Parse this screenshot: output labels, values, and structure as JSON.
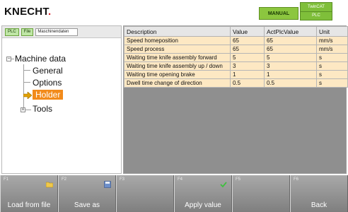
{
  "header": {
    "logo": "KNECHT",
    "logo_dot": ".",
    "mode": "MANUAL",
    "plc_top": "TwinCAT",
    "plc_bottom": "PLC"
  },
  "tree_header": {
    "plc_btn": "PLC",
    "file_btn": "File",
    "path": "Maschinendaten"
  },
  "tree": {
    "root": "Machine data",
    "items": [
      "General",
      "Options",
      "Holder",
      "Tools"
    ],
    "selected_index": 2
  },
  "table": {
    "columns": [
      "Description",
      "Value",
      "ActPlcValue",
      "Unit"
    ],
    "rows": [
      {
        "desc": "Speed homeposition",
        "val": "65",
        "act": "65",
        "unit": "mm/s"
      },
      {
        "desc": "Speed process",
        "val": "65",
        "act": "65",
        "unit": "mm/s"
      },
      {
        "desc": "Waiting time knife assembly forward",
        "val": "5",
        "act": "5",
        "unit": "s"
      },
      {
        "desc": "Waiting time knife assembly up / down",
        "val": "3",
        "act": "3",
        "unit": "s"
      },
      {
        "desc": "Waiting time opening brake",
        "val": "1",
        "act": "1",
        "unit": "s"
      },
      {
        "desc": "Dwell time change of direction",
        "val": "0.5",
        "act": "0.5",
        "unit": "s"
      }
    ]
  },
  "fkeys": [
    {
      "num": "F1",
      "label": "Load from file",
      "icon": "folder-icon"
    },
    {
      "num": "F2",
      "label": "Save as",
      "icon": "save-icon"
    },
    {
      "num": "F3",
      "label": "",
      "icon": ""
    },
    {
      "num": "F4",
      "label": "Apply value",
      "icon": "check-icon"
    },
    {
      "num": "F5",
      "label": "",
      "icon": ""
    },
    {
      "num": "F6",
      "label": "Back",
      "icon": ""
    }
  ],
  "colors": {
    "selected": "#f28b1b",
    "cell_bg": "#fde8c3",
    "mode_green": "#8cc63f"
  }
}
